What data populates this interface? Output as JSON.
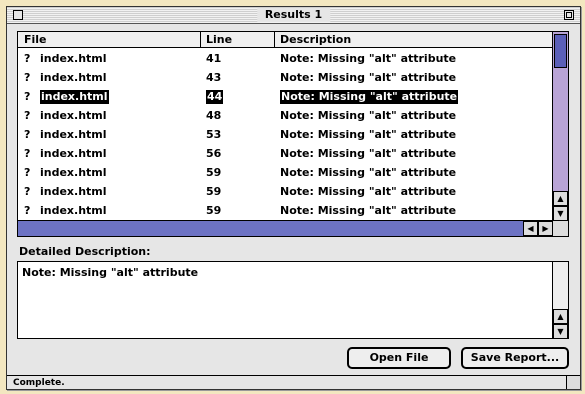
{
  "window": {
    "title": "Results 1"
  },
  "table": {
    "headers": {
      "file": "File",
      "line": "Line",
      "description": "Description"
    },
    "rows": [
      {
        "icon": "?",
        "file": "index.html",
        "line": "41",
        "description": "Note: Missing \"alt\" attribute",
        "selected": false
      },
      {
        "icon": "?",
        "file": "index.html",
        "line": "43",
        "description": "Note: Missing \"alt\" attribute",
        "selected": false
      },
      {
        "icon": "?",
        "file": "index.html",
        "line": "44",
        "description": "Note: Missing \"alt\" attribute",
        "selected": true
      },
      {
        "icon": "?",
        "file": "index.html",
        "line": "48",
        "description": "Note: Missing \"alt\" attribute",
        "selected": false
      },
      {
        "icon": "?",
        "file": "index.html",
        "line": "53",
        "description": "Note: Missing \"alt\" attribute",
        "selected": false
      },
      {
        "icon": "?",
        "file": "index.html",
        "line": "56",
        "description": "Note: Missing \"alt\" attribute",
        "selected": false
      },
      {
        "icon": "?",
        "file": "index.html",
        "line": "59",
        "description": "Note: Missing \"alt\" attribute",
        "selected": false
      },
      {
        "icon": "?",
        "file": "index.html",
        "line": "59",
        "description": "Note: Missing \"alt\" attribute",
        "selected": false
      },
      {
        "icon": "?",
        "file": "index.html",
        "line": "59",
        "description": "Note: Missing \"alt\" attribute",
        "selected": false
      }
    ]
  },
  "detail": {
    "label": "Detailed Description:",
    "text": "Note: Missing \"alt\" attribute"
  },
  "buttons": {
    "open_file": "Open File",
    "save_report": "Save Report..."
  },
  "status": {
    "text": "Complete."
  },
  "colors": {
    "scrollbar_track": "#b9a4d6",
    "scrollbar_thumb": "#5b5fb8",
    "selection": "#000000"
  },
  "icons": {
    "close": "close-box-icon",
    "zoom": "zoom-box-icon",
    "row_status": "question-mark-icon"
  }
}
